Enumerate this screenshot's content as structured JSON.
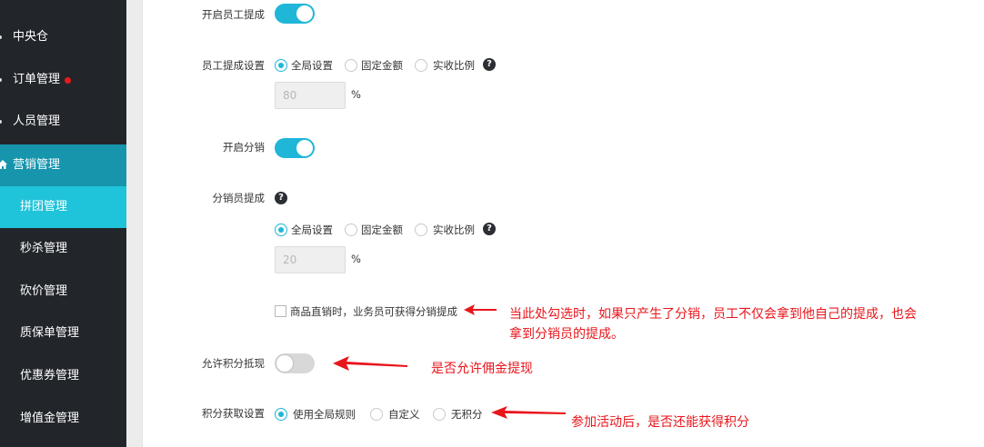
{
  "sidebar": {
    "items": [
      {
        "label": "中央仓"
      },
      {
        "label": "订单管理"
      },
      {
        "label": "人员管理"
      },
      {
        "label": "营销管理"
      },
      {
        "label": "拼团管理"
      },
      {
        "label": "秒杀管理"
      },
      {
        "label": "砍价管理"
      },
      {
        "label": "质保单管理"
      },
      {
        "label": "优惠券管理"
      },
      {
        "label": "增值金管理"
      }
    ]
  },
  "form": {
    "employee_commission_enable": {
      "label": "开启员工提成",
      "state": "on"
    },
    "employee_commission_setting": {
      "label": "员工提成设置",
      "options": [
        "全局设置",
        "固定金额",
        "实收比例"
      ],
      "selected": "全局设置",
      "value": "80",
      "unit": "%"
    },
    "distribution_enable": {
      "label": "开启分销",
      "state": "on"
    },
    "distributor_commission": {
      "label": "分销员提成",
      "options": [
        "全局设置",
        "固定金额",
        "实收比例"
      ],
      "selected": "全局设置",
      "value": "20",
      "unit": "%"
    },
    "direct_sale_checkbox": {
      "label": "商品直销时，业务员可获得分销提成",
      "checked": false
    },
    "allow_points_deduction": {
      "label": "允许积分抵现",
      "state": "off"
    },
    "points_acquisition": {
      "label": "积分获取设置",
      "options": [
        "使用全局规则",
        "自定义",
        "无积分"
      ],
      "selected": "使用全局规则"
    },
    "help_icon_glyph": "?"
  },
  "annotations": {
    "note1_line1": "当此处勾选时，如果只产生了分销，员工不仅会拿到他自己的提成，也会",
    "note1_line2": "拿到分销员的提成。",
    "note2": "是否允许佣金提现",
    "note3": "参加活动后，是否还能获得积分",
    "color": "#e8151b"
  },
  "colors": {
    "accent": "#1fb6d8",
    "sidebar_bg": "#22262b",
    "sidebar_active_parent": "#1695ad",
    "sidebar_active_child": "#1fc3da"
  }
}
